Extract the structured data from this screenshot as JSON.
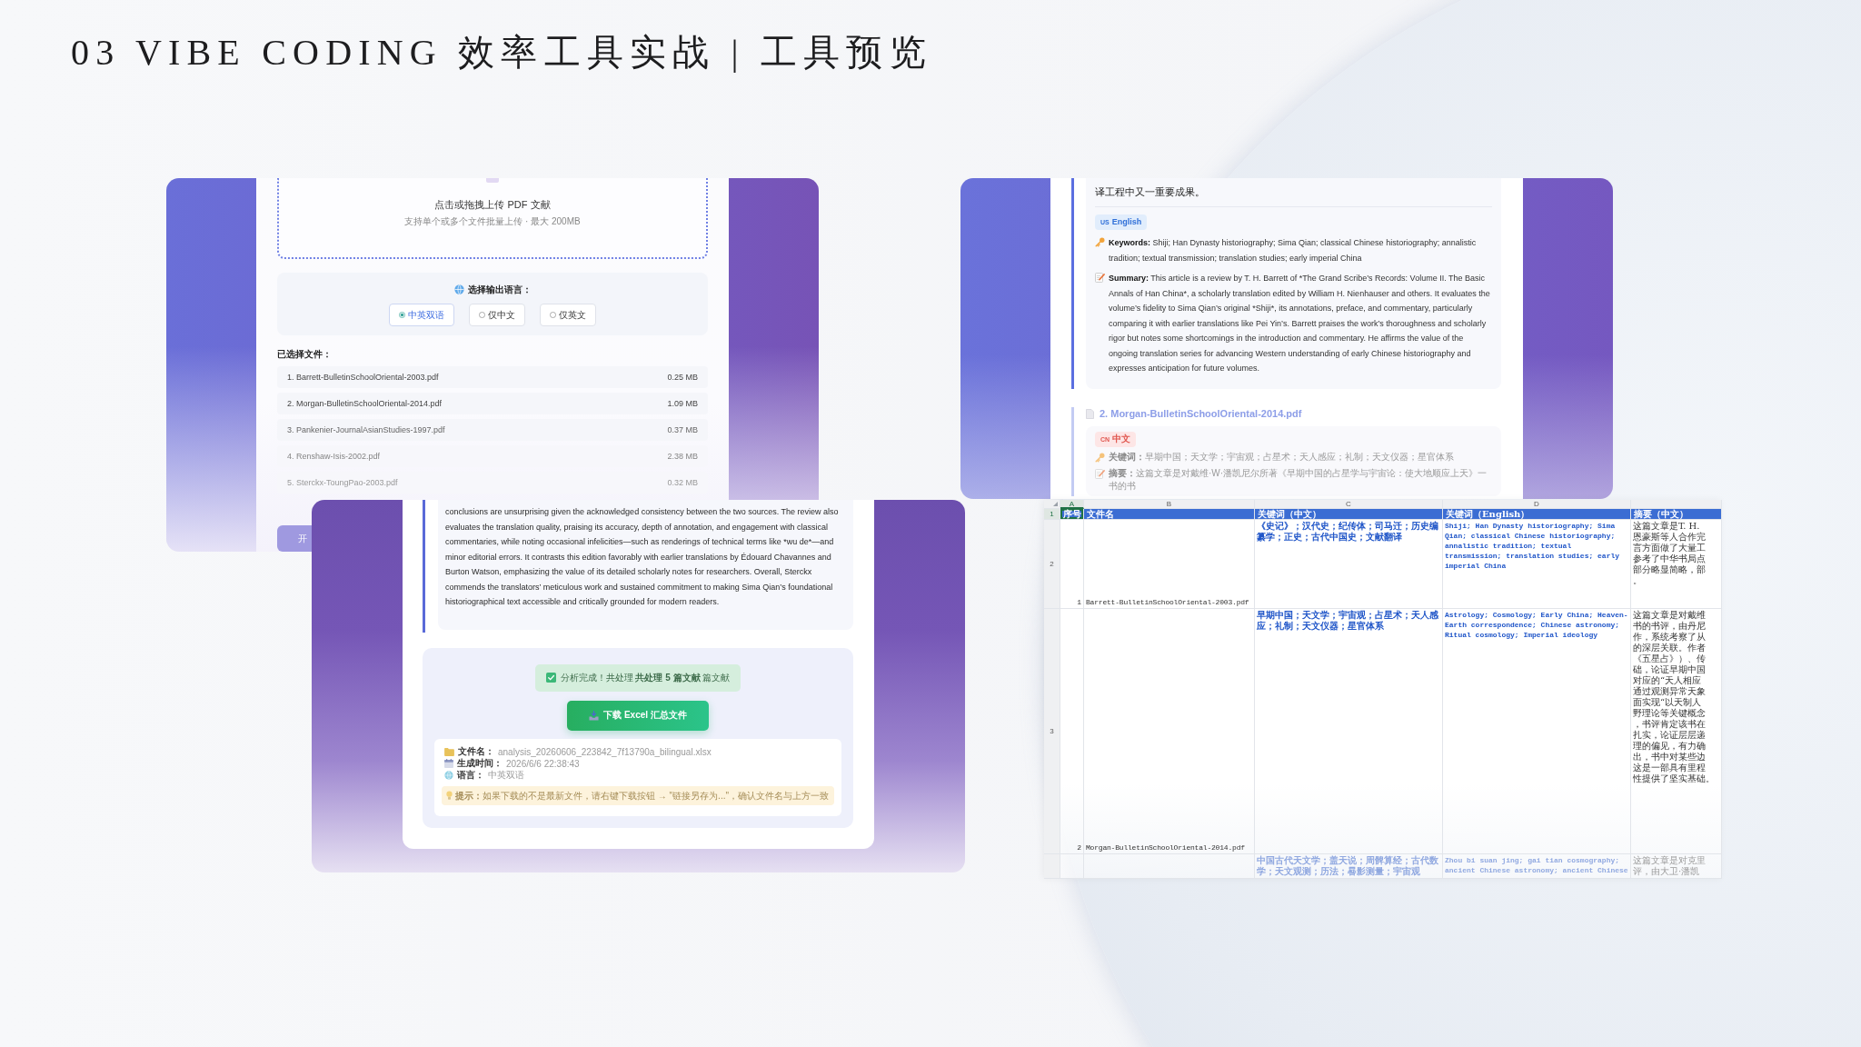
{
  "slide": {
    "title": "03 VIBE CODING 效率工具实战 | 工具预览"
  },
  "upload_screen": {
    "dropzone": {
      "title": "点击或拖拽上传 PDF 文献",
      "hint": "支持单个或多个文件批量上传 · 最大 200MB"
    },
    "output_language": {
      "label": "选择输出语言：",
      "options": [
        {
          "label": "中英双语",
          "selected": true
        },
        {
          "label": "仅中文",
          "selected": false
        },
        {
          "label": "仅英文",
          "selected": false
        }
      ]
    },
    "files_label": "已选择文件：",
    "files": [
      {
        "name": "1. Barrett-BulletinSchoolOriental-2003.pdf",
        "size": "0.25 MB"
      },
      {
        "name": "2. Morgan-BulletinSchoolOriental-2014.pdf",
        "size": "1.09 MB"
      },
      {
        "name": "3. Pankenier-JournalAsianStudies-1997.pdf",
        "size": "0.37 MB"
      },
      {
        "name": "4. Renshaw-Isis-2002.pdf",
        "size": "2.38 MB"
      },
      {
        "name": "5. Sterckx-ToungPao-2003.pdf",
        "size": "0.32 MB"
      }
    ],
    "start_button": "开"
  },
  "result_screen": {
    "summary_text": "conclusions are unsurprising given the acknowledged consistency between the two sources. The review also evaluates the translation quality, praising its accuracy, depth of annotation, and engagement with classical commentaries, while noting occasional infelicities—such as renderings of technical terms like *wu de*—and minor editorial errors. It contrasts this edition favorably with earlier translations by Édouard Chavannes and Burton Watson, emphasizing the value of its detailed scholarly notes for researchers. Overall, Sterckx commends the translators’ meticulous work and sustained commitment to making Sima Qian’s foundational historiographical text accessible and critically grounded for modern readers.",
    "status": "分析完成！共处理 **共处理 5 篇文献** 篇文献",
    "download_button": "下载 Excel 汇总文件",
    "file_info": [
      {
        "label": "文件名：",
        "value": "analysis_20260606_223842_7f13790a_bilingual.xlsx"
      },
      {
        "label": "生成时间：",
        "value": "2026/6/6 22:38:43"
      },
      {
        "label": "语言：",
        "value": "中英双语"
      }
    ],
    "tip": "**提示：**如果下载的不是最新文件，请右键下载按钮 → \"链接另存为...\"，确认文件名与上方一致"
  },
  "detail_screen": {
    "previous_summary_end": "译工程中又一重要成果。",
    "english_tag": {
      "flag": "US",
      "label": "English"
    },
    "keywords": {
      "label": "Keywords:",
      "text": "Shiji; Han Dynasty historiography; Sima Qian; classical Chinese historiography; annalistic tradition; textual transmission; translation studies; early imperial China"
    },
    "summary": {
      "label": "Summary:",
      "text": "This article is a review by T. H. Barrett of *The Grand Scribe’s Records: Volume II. The Basic Annals of Han China*, a scholarly translation edited by William H. Nienhauser and others. It evaluates the volume’s fidelity to Sima Qian’s original *Shiji*, its annotations, preface, and commentary, particularly comparing it with earlier translations like Pei Yin’s. Barrett praises the work’s thoroughness and scholarly rigor but notes some shortcomings in the introduction and commentary. He affirms the value of the ongoing translation series for advancing Western understanding of early Chinese historiography and expresses anticipation for future volumes."
    },
    "next_file": "2. Morgan-BulletinSchoolOriental-2014.pdf",
    "chinese_tag": {
      "flag": "CN",
      "label": "中文"
    },
    "chinese_keywords": {
      "label": "关键词：",
      "text": "早期中国；天文学；宇宙观；占星术；天人感应；礼制；天文仪器；星官体系"
    },
    "chinese_summary": {
      "label": "摘要：",
      "text": "这篇文章是对戴维·W·潘凯尼尔所著《早期中国的占星学与宇宙论：使大地顺应上天》一书的书"
    }
  },
  "spreadsheet": {
    "column_letters": [
      {
        "label": "A",
        "selected": true
      },
      {
        "label": "B",
        "selected": false
      },
      {
        "label": "C",
        "selected": false
      },
      {
        "label": "D",
        "selected": false
      }
    ],
    "row_numbers": [
      {
        "label": "1",
        "selected": true
      },
      {
        "label": "2",
        "selected": false
      },
      {
        "label": "3",
        "selected": false
      }
    ],
    "header": [
      "序号",
      "文件名",
      "关键词（中文）",
      "关键词（English）",
      "摘要（中文）"
    ],
    "rows": [
      {
        "number": "1",
        "file_name": "Barrett-BulletinSchoolOriental-2003.pdf",
        "keywords_zh": "《史记》；汉代史；纪传体；司马迁；历史编纂学；正史；古代中国史；文献翻译",
        "keywords_en": "Shiji; Han Dynasty historiography; Sima Qian; classical Chinese historiography; annalistic tradition; textual transmission; translation studies; early imperial China",
        "summary_zh_lines": [
          "这篇文章是T. H.",
          "恩豪斯等人合作完",
          "言方面做了大量工",
          "参考了中华书局点",
          "部分略显简略，部",
          "。"
        ]
      },
      {
        "number": "2",
        "file_name": "Morgan-BulletinSchoolOriental-2014.pdf",
        "keywords_zh": "早期中国；天文学；宇宙观；占星术；天人感应；礼制；天文仪器；星官体系",
        "keywords_en": "Astrology; Cosmology; Early China; Heaven-Earth correspondence; Chinese astronomy; Ritual cosmology; Imperial ideology",
        "summary_zh_lines": [
          "这篇文章是对戴维",
          "书的书评，由丹尼",
          "作，系统考察了从",
          "的深层关联。作者",
          "《五星占》）、传",
          "础，论证早期中国",
          "对应的“天人相应",
          "通过观测异常天象",
          "面实现“以天制人",
          "野理论等关键概念",
          "，书评肯定该书在",
          "扎实，论证层层递",
          "理的偏见，有力确",
          "出，书中对某些边",
          "这是一部具有里程",
          "性提供了坚实基础。"
        ]
      },
      {
        "keywords_zh": "中国古代天文学；盖天说；周髀算经；古代数学；天文观测；历法；晷影测量；宇宙观",
        "keywords_en": "Zhou bi suan jing; gai tian cosmography; ancient Chinese astronomy; ancient Chinese",
        "summary_zh_lines": [
          "这篇文章是对克里",
          "评，由大卫·潘凯"
        ]
      }
    ]
  }
}
